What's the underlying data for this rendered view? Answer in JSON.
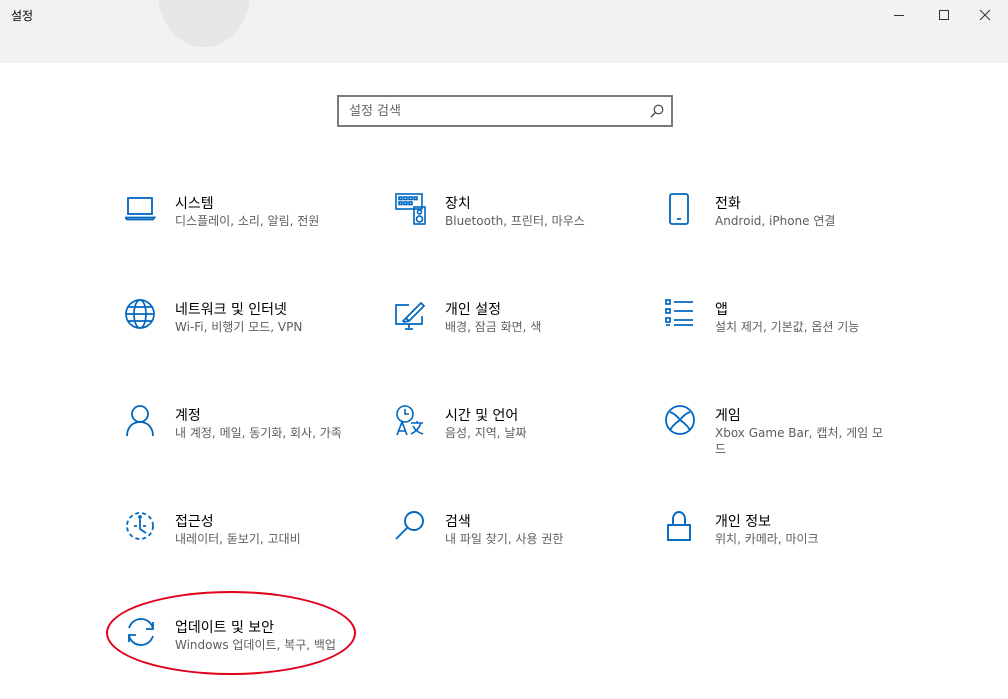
{
  "window": {
    "title": "설정",
    "controls": [
      "minimize",
      "maximize",
      "close"
    ]
  },
  "search": {
    "placeholder": "설정 검색",
    "value": ""
  },
  "colors": {
    "accent": "#0067c0",
    "titlebar_bg": "#f2f2f2",
    "description_text": "#5d5d5d",
    "annotation": "#e0001a"
  },
  "tiles": [
    {
      "title": "시스템",
      "description": "디스플레이, 소리, 알림, 전원",
      "icon": "laptop-icon"
    },
    {
      "title": "장치",
      "description": "Bluetooth, 프린터, 마우스",
      "icon": "keyboard-icon"
    },
    {
      "title": "전화",
      "description": "Android, iPhone 연결",
      "icon": "phone-icon"
    },
    {
      "title": "네트워크 및 인터넷",
      "description": "Wi-Fi, 비행기 모드, VPN",
      "icon": "globe-icon"
    },
    {
      "title": "개인 설정",
      "description": "배경, 잠금 화면, 색",
      "icon": "paint-icon"
    },
    {
      "title": "앱",
      "description": "설치 제거, 기본값, 옵션 기능",
      "icon": "apps-list-icon"
    },
    {
      "title": "계정",
      "description": "내 계정, 메일, 동기화, 회사, 가족",
      "icon": "person-icon"
    },
    {
      "title": "시간 및 언어",
      "description": "음성, 지역, 날짜",
      "icon": "time-language-icon"
    },
    {
      "title": "게임",
      "description": "Xbox Game Bar, 캡처, 게임 모드",
      "icon": "xbox-icon"
    },
    {
      "title": "접근성",
      "description": "내레이터, 돋보기, 고대비",
      "icon": "accessibility-icon"
    },
    {
      "title": "검색",
      "description": "내 파일 찾기, 사용 권한",
      "icon": "search-icon"
    },
    {
      "title": "개인 정보",
      "description": "위치, 카메라, 마이크",
      "icon": "lock-icon"
    },
    {
      "title": "업데이트 및 보안",
      "description": "Windows 업데이트, 복구, 백업",
      "icon": "sync-icon"
    }
  ]
}
